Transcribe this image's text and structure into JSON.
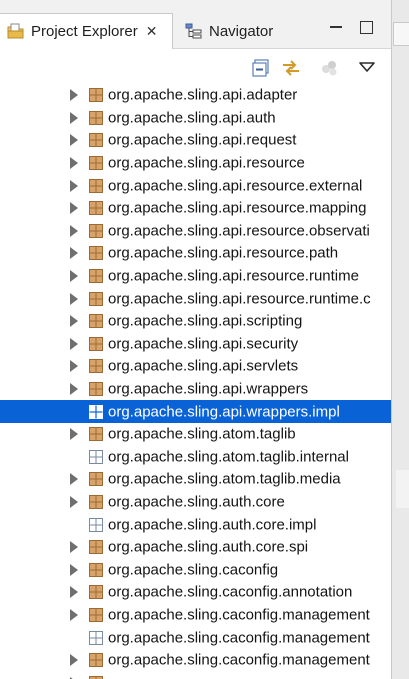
{
  "tabs": {
    "project_explorer": "Project Explorer",
    "navigator": "Navigator",
    "close_glyph": "✕"
  },
  "icons": {
    "project_explorer": "project-explorer-icon",
    "navigator": "navigator-icon",
    "collapse_all": "collapse-all-icon",
    "link_with_editor": "link-with-editor-icon",
    "filter": "filter-icon",
    "view_menu": "view-menu-icon",
    "package": "package-icon",
    "empty_package": "empty-package-icon",
    "expand": "chevron-right-icon"
  },
  "colors": {
    "selection": "#0a63d6",
    "package_fill": "#d8a36a",
    "package_stroke": "#9c6b33",
    "empty_package_stroke": "#7a8aa0",
    "twisty": "#6f6f6f"
  },
  "tree": [
    {
      "label": "org.apache.sling.api.adapter",
      "expandable": true,
      "empty": false,
      "selected": false
    },
    {
      "label": "org.apache.sling.api.auth",
      "expandable": true,
      "empty": false,
      "selected": false
    },
    {
      "label": "org.apache.sling.api.request",
      "expandable": true,
      "empty": false,
      "selected": false
    },
    {
      "label": "org.apache.sling.api.resource",
      "expandable": true,
      "empty": false,
      "selected": false
    },
    {
      "label": "org.apache.sling.api.resource.external",
      "expandable": true,
      "empty": false,
      "selected": false
    },
    {
      "label": "org.apache.sling.api.resource.mapping",
      "expandable": true,
      "empty": false,
      "selected": false
    },
    {
      "label": "org.apache.sling.api.resource.observati",
      "expandable": true,
      "empty": false,
      "selected": false
    },
    {
      "label": "org.apache.sling.api.resource.path",
      "expandable": true,
      "empty": false,
      "selected": false
    },
    {
      "label": "org.apache.sling.api.resource.runtime",
      "expandable": true,
      "empty": false,
      "selected": false
    },
    {
      "label": "org.apache.sling.api.resource.runtime.c",
      "expandable": true,
      "empty": false,
      "selected": false
    },
    {
      "label": "org.apache.sling.api.scripting",
      "expandable": true,
      "empty": false,
      "selected": false
    },
    {
      "label": "org.apache.sling.api.security",
      "expandable": true,
      "empty": false,
      "selected": false
    },
    {
      "label": "org.apache.sling.api.servlets",
      "expandable": true,
      "empty": false,
      "selected": false
    },
    {
      "label": "org.apache.sling.api.wrappers",
      "expandable": true,
      "empty": false,
      "selected": false
    },
    {
      "label": "org.apache.sling.api.wrappers.impl",
      "expandable": false,
      "empty": false,
      "selected": true
    },
    {
      "label": "org.apache.sling.atom.taglib",
      "expandable": true,
      "empty": false,
      "selected": false
    },
    {
      "label": "org.apache.sling.atom.taglib.internal",
      "expandable": false,
      "empty": true,
      "selected": false
    },
    {
      "label": "org.apache.sling.atom.taglib.media",
      "expandable": true,
      "empty": false,
      "selected": false
    },
    {
      "label": "org.apache.sling.auth.core",
      "expandable": true,
      "empty": false,
      "selected": false
    },
    {
      "label": "org.apache.sling.auth.core.impl",
      "expandable": false,
      "empty": true,
      "selected": false
    },
    {
      "label": "org.apache.sling.auth.core.spi",
      "expandable": true,
      "empty": false,
      "selected": false
    },
    {
      "label": "org.apache.sling.caconfig",
      "expandable": true,
      "empty": false,
      "selected": false
    },
    {
      "label": "org.apache.sling.caconfig.annotation",
      "expandable": true,
      "empty": false,
      "selected": false
    },
    {
      "label": "org.apache.sling.caconfig.management",
      "expandable": true,
      "empty": false,
      "selected": false
    },
    {
      "label": "org.apache.sling.caconfig.management",
      "expandable": false,
      "empty": true,
      "selected": false
    },
    {
      "label": "org.apache.sling.caconfig.management",
      "expandable": true,
      "empty": false,
      "selected": false
    },
    {
      "label": "",
      "expandable": true,
      "empty": false,
      "selected": false
    }
  ]
}
